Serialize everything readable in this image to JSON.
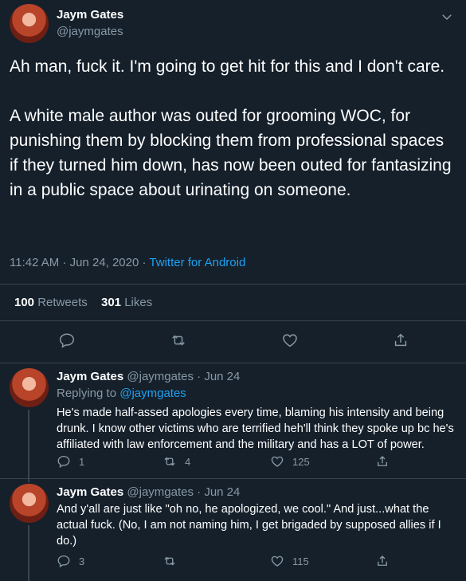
{
  "main_tweet": {
    "author_name": "Jaym Gates",
    "author_handle": "@jaymgates",
    "paragraph_1": "Ah man, fuck it. I'm going to get hit for this and I don't care.",
    "paragraph_2": "A white male author was outed for grooming WOC, for punishing them by blocking them from professional spaces if they turned him down, has now been outed for fantasizing in a public space about urinating on someone.",
    "timestamp": "11:42 AM · Jun 24, 2020",
    "separator": " · ",
    "source": "Twitter for Android",
    "retweets_count": "100",
    "retweets_label": "Retweets",
    "likes_count": "301",
    "likes_label": "Likes"
  },
  "replies": [
    {
      "author_name": "Jaym Gates",
      "author_handle": "@jaymgates · Jun 24",
      "replying_prefix": "Replying to ",
      "replying_to": "@jaymgates",
      "text": "He's made half-assed apologies every time, blaming his intensity and being drunk. I know other victims who are terrified heh'll think they spoke up bc he's affiliated with law enforcement and the military and has a LOT of power.",
      "reply_count": "1",
      "retweet_count": "4",
      "like_count": "125"
    },
    {
      "author_name": "Jaym Gates",
      "author_handle": "@jaymgates · Jun 24",
      "text": "And y'all are just like \"oh no, he apologized, we cool.\" And just...what the actual fuck. (No, I am not naming him, I get brigaded by supposed allies if I do.)",
      "reply_count": "3",
      "retweet_count": "",
      "like_count": "115"
    }
  ],
  "colors": {
    "background": "#15202b",
    "text": "#ffffff",
    "muted": "#8899a6",
    "link": "#1da1f2",
    "border": "#38444d"
  },
  "icons": [
    "chevron-down-icon",
    "reply-icon",
    "retweet-icon",
    "like-icon",
    "share-icon"
  ]
}
